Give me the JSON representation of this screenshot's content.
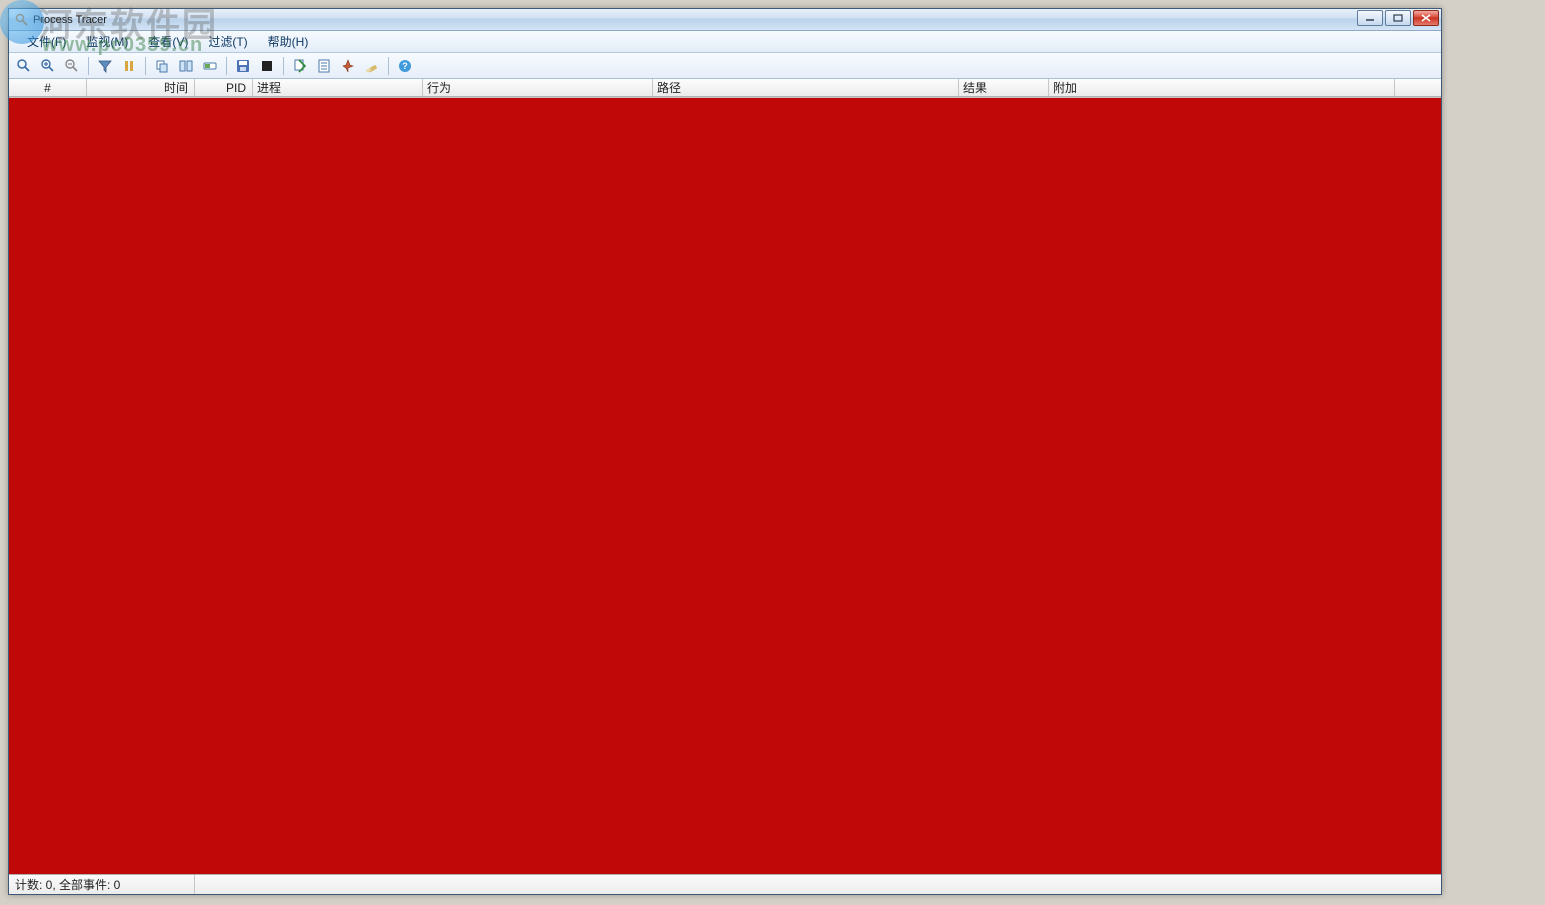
{
  "window": {
    "title": "Process Tracer"
  },
  "menu": {
    "file": "文件(F)",
    "monitor": "监视(M)",
    "view": "查看(V)",
    "filter": "过滤(T)",
    "help": "帮助(H)"
  },
  "toolbar_icons": {
    "find": "find-icon",
    "zoom_in": "zoom-in-icon",
    "zoom_out": "zoom-out-icon",
    "filter": "filter-icon",
    "pause": "pause-icon",
    "copy": "copy-icon",
    "split": "split-icon",
    "toggle": "toggle-icon",
    "save": "save-icon",
    "stop": "stop-icon",
    "jump": "jump-icon",
    "properties": "properties-icon",
    "pin": "pin-icon",
    "clear": "clear-icon",
    "help": "help-icon"
  },
  "columns": {
    "seq": "#",
    "time": "时间",
    "pid": "PID",
    "process": "进程",
    "action": "行为",
    "path": "路径",
    "result": "结果",
    "attach": "附加"
  },
  "column_widths": {
    "seq": 78,
    "time": 108,
    "pid": 58,
    "process": 170,
    "action": 230,
    "path": 306,
    "result": 90,
    "attach": 346,
    "extra": 28
  },
  "statusbar": {
    "counts": "计数: 0, 全部事件: 0",
    "pane1_width": 186
  },
  "watermark": {
    "line1": "河东软件园",
    "line2": "www.pc0359.cn"
  }
}
